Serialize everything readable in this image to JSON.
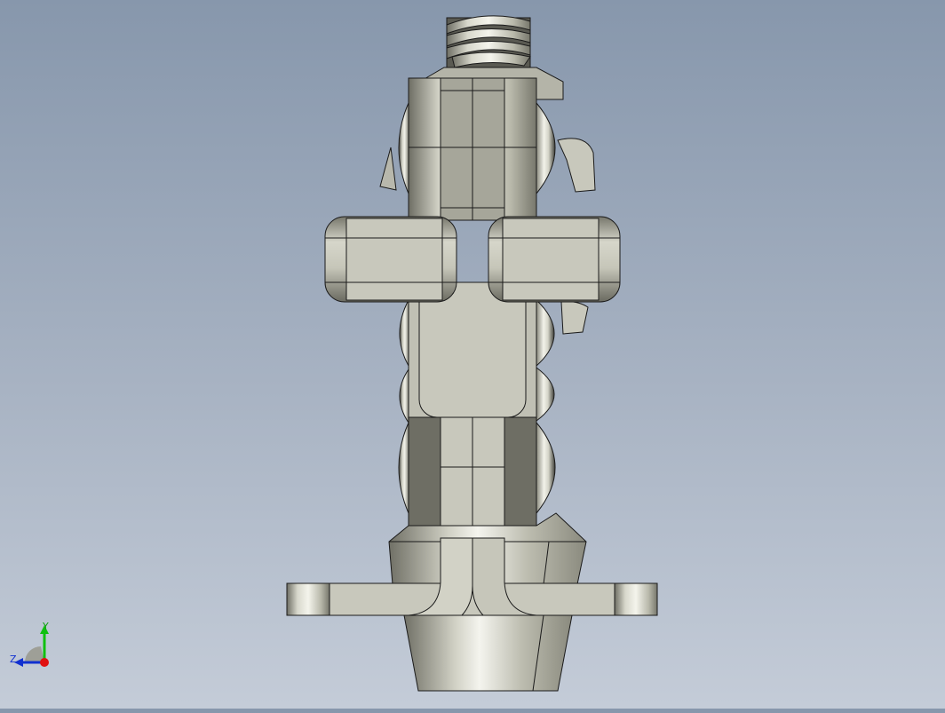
{
  "view": {
    "background_top": "#8797ac",
    "background_bottom": "#c4ccd8",
    "part_color": "#c8c8bc",
    "edge_color": "#1a1a1a"
  },
  "triad": {
    "y_label": "Y",
    "z_label": "Z",
    "x_color": "#e01010",
    "y_color": "#10c010",
    "z_color": "#1030d0"
  }
}
